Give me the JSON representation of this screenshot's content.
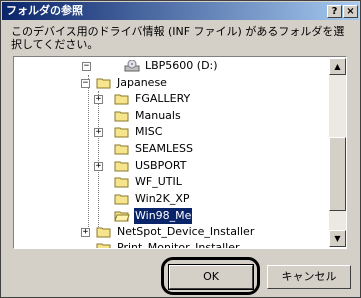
{
  "dialog": {
    "title": "フォルダの参照",
    "help_label": "?",
    "close_label": "×",
    "description": "このデバイス用のドライバ情報 (INF ファイル) があるフォルダを選択してください。"
  },
  "tree": {
    "items": [
      {
        "label": "LBP5600 (D:)",
        "icon": "cd-drive-icon",
        "expander": "−"
      },
      {
        "label": "Japanese",
        "icon": "folder-open-icon",
        "expander": "−"
      },
      {
        "label": "FGALLERY",
        "icon": "folder-icon",
        "expander": "+"
      },
      {
        "label": "Manuals",
        "icon": "folder-icon",
        "expander": ""
      },
      {
        "label": "MISC",
        "icon": "folder-icon",
        "expander": "+"
      },
      {
        "label": "SEAMLESS",
        "icon": "folder-icon",
        "expander": ""
      },
      {
        "label": "USBPORT",
        "icon": "folder-icon",
        "expander": "+"
      },
      {
        "label": "WF_UTIL",
        "icon": "folder-icon",
        "expander": ""
      },
      {
        "label": "Win2K_XP",
        "icon": "folder-icon",
        "expander": ""
      },
      {
        "label": "Win98_Me",
        "icon": "folder-open-icon",
        "expander": "",
        "selected": true
      },
      {
        "label": "NetSpot_Device_Installer",
        "icon": "folder-icon",
        "expander": "+"
      },
      {
        "label": "Print_Monitor_Installer",
        "icon": "folder-icon",
        "expander": ""
      }
    ]
  },
  "scrollbar": {
    "up_arrow": "▲",
    "down_arrow": "▼"
  },
  "buttons": {
    "ok_label": "OK",
    "cancel_label": "キャンセル"
  }
}
